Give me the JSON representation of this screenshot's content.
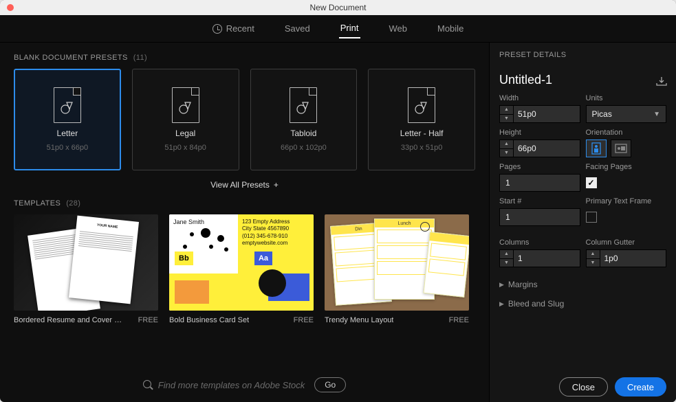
{
  "window": {
    "title": "New Document"
  },
  "tabs": {
    "recent": "Recent",
    "saved": "Saved",
    "print": "Print",
    "web": "Web",
    "mobile": "Mobile",
    "active": "print"
  },
  "presets": {
    "header": "BLANK DOCUMENT PRESETS",
    "count": "(11)",
    "view_all": "View All Presets",
    "items": [
      {
        "name": "Letter",
        "dim": "51p0 x 66p0",
        "selected": true
      },
      {
        "name": "Legal",
        "dim": "51p0 x 84p0",
        "selected": false
      },
      {
        "name": "Tabloid",
        "dim": "66p0 x 102p0",
        "selected": false
      },
      {
        "name": "Letter - Half",
        "dim": "33p0 x 51p0",
        "selected": false
      }
    ]
  },
  "templates": {
    "header": "TEMPLATES",
    "count": "(28)",
    "items": [
      {
        "name": "Bordered Resume and Cover Let...",
        "price": "FREE"
      },
      {
        "name": "Bold Business Card Set",
        "price": "FREE"
      },
      {
        "name": "Trendy Menu Layout",
        "price": "FREE"
      }
    ],
    "biz_card": {
      "name": "Jane Smith",
      "addr1": "123 Empty Address",
      "addr2": "City State 4567890",
      "phone": "(012) 345-678-910",
      "site": "emptywebsite.com",
      "bb": "Bb",
      "aa": "Aa"
    },
    "menu": {
      "din": "Din",
      "lunch": "Lunch"
    },
    "resume": {
      "your_name": "YOUR NAME"
    }
  },
  "search": {
    "placeholder": "Find more templates on Adobe Stock",
    "go": "Go"
  },
  "side": {
    "header": "PRESET DETAILS",
    "doc_name": "Untitled-1",
    "width_label": "Width",
    "width": "51p0",
    "units_label": "Units",
    "units": "Picas",
    "height_label": "Height",
    "height": "66p0",
    "orient_label": "Orientation",
    "pages_label": "Pages",
    "pages": "1",
    "facing_label": "Facing Pages",
    "facing": true,
    "start_label": "Start #",
    "start": "1",
    "ptf_label": "Primary Text Frame",
    "ptf": false,
    "columns_label": "Columns",
    "columns": "1",
    "gutter_label": "Column Gutter",
    "gutter": "1p0",
    "margins": "Margins",
    "bleed": "Bleed and Slug"
  },
  "footer": {
    "close": "Close",
    "create": "Create"
  }
}
